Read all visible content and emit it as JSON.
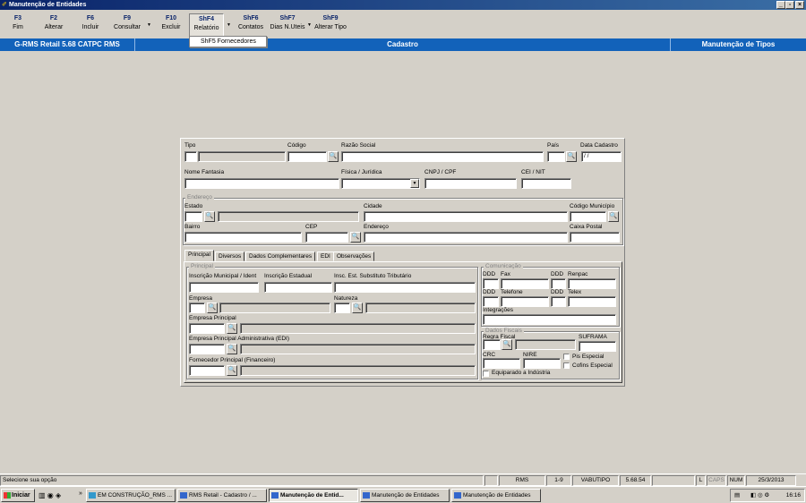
{
  "window": {
    "title": "Manutenção de Entidades"
  },
  "toolbar": [
    {
      "key": "F3",
      "label": "Fim"
    },
    {
      "key": "F2",
      "label": "Alterar"
    },
    {
      "key": "F6",
      "label": "Incluir"
    },
    {
      "key": "F9",
      "label": "Consultar"
    },
    {
      "key": "F10",
      "label": "Excluir"
    },
    {
      "key": "ShF4",
      "label": "Relatório"
    },
    {
      "key": "ShF6",
      "label": "Contatos"
    },
    {
      "key": "ShF7",
      "label": "Dias N.Uteis"
    },
    {
      "key": "ShF9",
      "label": "Alterar Tipo"
    }
  ],
  "dropdown": {
    "item": "ShF5  Fornecedores"
  },
  "bluebar": {
    "left": "G-RMS Retail 5.68 CATPC RMS",
    "center": "Cadastro",
    "right": "Manutenção de Tipos"
  },
  "form": {
    "tipo": "Tipo",
    "codigo": "Código",
    "razao_social": "Razão Social",
    "pais": "País",
    "data_cadastro": "Data Cadastro",
    "data_cadastro_value": " / /",
    "nome_fantasia": "Nome Fantasia",
    "fisica_juridica": "Física / Jurídica",
    "cnpj_cpf": "CNPJ / CPF",
    "cei_nit": "CEI / NIT",
    "endereco_group": "Endereço",
    "estado": "Estado",
    "cidade": "Cidade",
    "codigo_municipio": "Código Município",
    "bairro": "Bairro",
    "cep": "CEP",
    "endereco": "Endereço",
    "caixa_postal": "Caixa Postal"
  },
  "tabs": [
    "Principal",
    "Diversos",
    "Dados Complementares",
    "EDI",
    "Observações"
  ],
  "principal": {
    "group": "Principal",
    "insc_municipal": "Inscrição Municipal / Ident",
    "insc_estadual": "Inscrição Estadual",
    "insc_substituto": "Insc. Est. Substituto Tributário",
    "empresa": "Empresa",
    "natureza": "Natureza",
    "empresa_principal": "Empresa Principal",
    "empresa_principal_adm": "Empresa Principal Administrativa (EDI)",
    "fornecedor_principal": "Fornecedor Principal (Financeiro)"
  },
  "comunicacao": {
    "group": "Comunicação",
    "ddd": "DDD",
    "fax": "Fax",
    "renpac": "Renpac",
    "telefone": "Telefone",
    "telex": "Telex",
    "integracoes": "Integrações"
  },
  "fiscais": {
    "group": "Dados Fiscais",
    "regra_fiscal": "Regra Fiscal",
    "suframa": "SUFRAMA",
    "crc": "CRC",
    "nire": "NIRE",
    "pis_especial": "Pis Especial",
    "cofins_especial": "Cofins Especial",
    "equiparado": "Equiparado a Indústria"
  },
  "status": {
    "message": "Selecione sua opção",
    "cells": [
      "RMS",
      "1-9",
      "VABUTIPO",
      "5.68.54",
      "L",
      "CAPS",
      "NUM",
      "25/3/2013"
    ]
  },
  "taskbar": {
    "start": "Iniciar",
    "tasks": [
      "EM CONSTRUÇÃO_RMS ...",
      "RMS Retail - Cadastro / ...",
      "Manutenção de Entid...",
      "Manutenção de Entidades",
      "Manutenção de Entidades"
    ],
    "clock": "16:16"
  },
  "colors": {
    "title": "#0a246a",
    "bluebar": "#1262ba",
    "face": "#d4d0c8"
  }
}
